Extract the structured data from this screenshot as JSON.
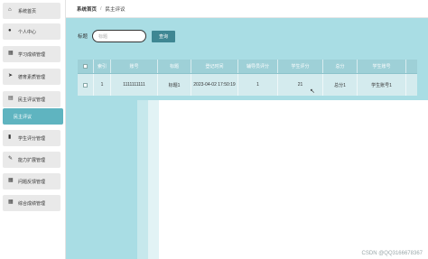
{
  "sidebar": {
    "items": [
      {
        "label": "系统首页",
        "icon": "home-icon",
        "glyph": "⌂"
      },
      {
        "label": "个人中心",
        "icon": "user-icon",
        "glyph": "●"
      },
      {
        "label": "学习成绩管理",
        "icon": "grid-icon",
        "glyph": "▦"
      },
      {
        "label": "德育素质管理",
        "icon": "send-icon",
        "glyph": "➤"
      },
      {
        "label": "民主评议管理",
        "icon": "doc-icon",
        "glyph": "▤"
      },
      {
        "label": "民主评议",
        "icon": "",
        "glyph": ""
      },
      {
        "label": "学生评分管理",
        "icon": "bookmark-icon",
        "glyph": "▮"
      },
      {
        "label": "能力扩展管理",
        "icon": "tools-icon",
        "glyph": "✎"
      },
      {
        "label": "问题反馈管理",
        "icon": "grid2-icon",
        "glyph": "▦"
      },
      {
        "label": "综合成绩管理",
        "icon": "grid3-icon",
        "glyph": "▦"
      }
    ]
  },
  "header": {
    "home": "系统首页",
    "current": "民主评议"
  },
  "search": {
    "label": "标题",
    "placeholder": "标题",
    "button": "查询"
  },
  "table": {
    "columns": [
      "",
      "索引",
      "账号",
      "标题",
      "登记时间",
      "辅导员评分",
      "学生评分",
      "总分",
      "学生账号",
      ""
    ],
    "rows": [
      [
        "",
        "1",
        "1111111111",
        "标题1",
        "2023-04-02 17:50:19",
        "1",
        "21",
        "总分1",
        "学生账号1",
        ""
      ]
    ]
  },
  "watermark": "CSDN @QQ3166678367"
}
